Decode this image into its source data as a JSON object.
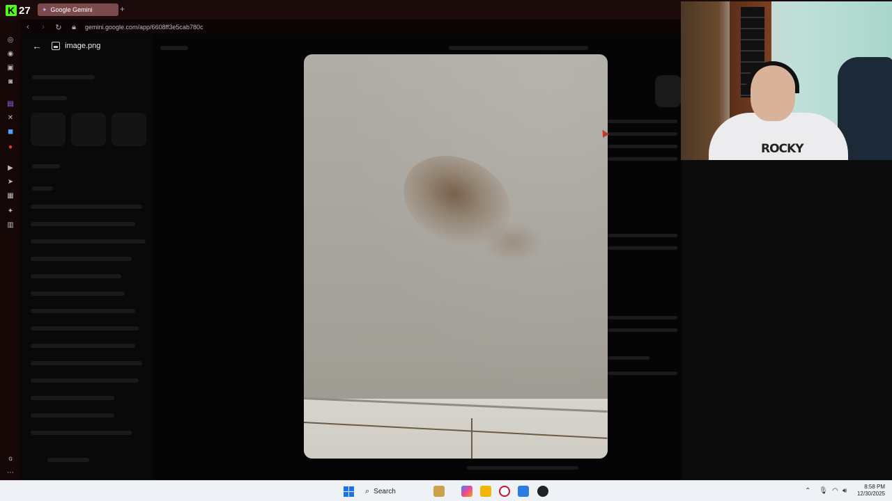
{
  "browser": {
    "brand_count": "27",
    "tab_title": "Google Gemini",
    "new_tab": "+",
    "url": "gemini.google.com/app/6608ff3e5cab780c"
  },
  "viewer": {
    "file_name": "image.png"
  },
  "webcam": {
    "shirt_text": "ROCKY"
  },
  "taskbar": {
    "search_label": "Search",
    "time": "8:58 PM",
    "date": "12/30/2025"
  },
  "colors": {
    "kick_green": "#53fc18",
    "tab_bg": "#7b4a4c",
    "taskbar_bg": "#eef1f6"
  }
}
